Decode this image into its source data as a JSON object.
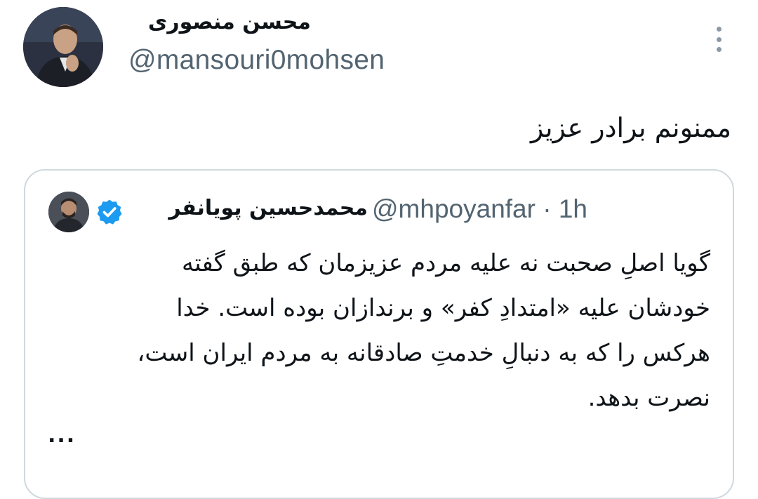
{
  "tweet": {
    "author_name": "محسن منصوری",
    "author_handle": "@mansouri0mohsen",
    "text": "ممنونم برادر عزیز",
    "more_icon": "more-vertical-icon"
  },
  "quote": {
    "author_name": "محمدحسین پویانفر",
    "author_handle": "@mhpoyanfar",
    "separator": "·",
    "time": "1h",
    "verified_icon": "verified-badge-icon",
    "verified_color": "#1d9bf0",
    "lines": [
      "گویا اصلِ صحبت نه علیه مردم عزیزمان که طبق گفته",
      "خودشان علیه «امتدادِ کفر» و برندازان بوده است. خدا",
      "هرکس را که به دنبالِ خدمتِ صادقانه به مردم ایران است،",
      "نصرت بدهد."
    ],
    "truncation": "..."
  },
  "colors": {
    "text_primary": "#0f1419",
    "text_secondary": "#536471",
    "border": "#cfd9de",
    "background": "#ffffff"
  }
}
